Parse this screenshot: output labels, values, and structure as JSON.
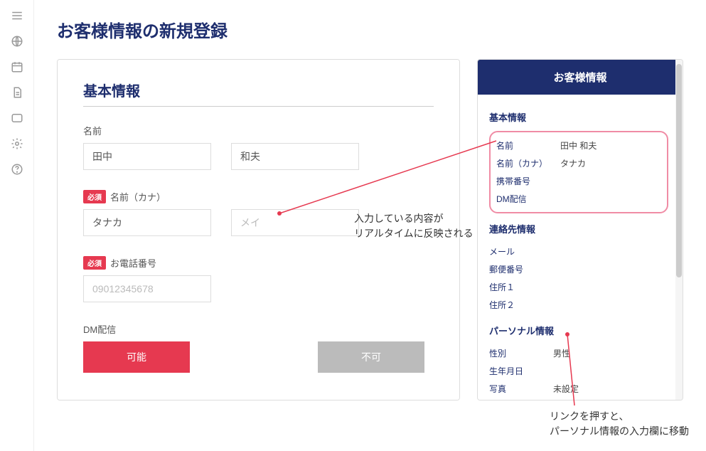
{
  "pageTitle": "お客様情報の新規登録",
  "form": {
    "sectionTitle": "基本情報",
    "nameLabel": "名前",
    "nameLast": "田中",
    "nameFirst": "和夫",
    "requiredBadge": "必須",
    "kanaLabel": "名前（カナ）",
    "kanaLast": "タナカ",
    "kanaFirstPlaceholder": "メイ",
    "phoneLabel": "お電話番号",
    "phonePlaceholder": "09012345678",
    "dmLabel": "DM配信",
    "btnPossible": "可能",
    "btnNotPossible": "不可"
  },
  "summary": {
    "header": "お客様情報",
    "basic": {
      "title": "基本情報",
      "nameLabel": "名前",
      "nameValue": "田中 和夫",
      "kanaLabel": "名前（カナ）",
      "kanaValue": "タナカ",
      "phoneLabel": "携帯番号",
      "dmLabel": "DM配信"
    },
    "contact": {
      "title": "連絡先情報",
      "mailLabel": "メール",
      "zipLabel": "郵便番号",
      "addr1Label": "住所１",
      "addr2Label": "住所２"
    },
    "personal": {
      "title": "パーソナル情報",
      "genderLabel": "性別",
      "genderValue": "男性",
      "birthLabel": "生年月日",
      "photoLabel": "写真",
      "photoValue": "未設定"
    }
  },
  "annotations": {
    "a1l1": "入力している内容が",
    "a1l2": "リアルタイムに反映される",
    "a2l1": "リンクを押すと、",
    "a2l2": "パーソナル情報の入力欄に移動"
  }
}
